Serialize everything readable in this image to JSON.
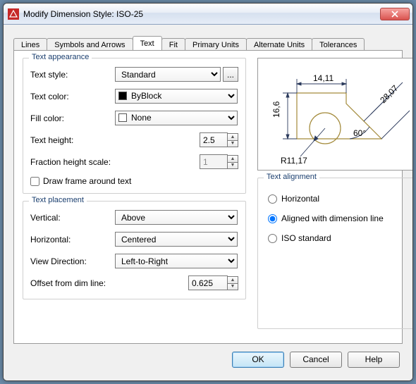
{
  "window": {
    "title": "Modify Dimension Style: ISO-25"
  },
  "tabs": {
    "items": [
      {
        "label": "Lines"
      },
      {
        "label": "Symbols and Arrows"
      },
      {
        "label": "Text"
      },
      {
        "label": "Fit"
      },
      {
        "label": "Primary Units"
      },
      {
        "label": "Alternate Units"
      },
      {
        "label": "Tolerances"
      }
    ],
    "active_index": 2
  },
  "text_appearance": {
    "legend": "Text appearance",
    "text_style_label": "Text style:",
    "text_style_value": "Standard",
    "text_color_label": "Text color:",
    "text_color_value": "ByBlock",
    "fill_color_label": "Fill color:",
    "fill_color_value": "None",
    "text_height_label": "Text height:",
    "text_height_value": "2.5",
    "fraction_scale_label": "Fraction height scale:",
    "fraction_scale_value": "1",
    "draw_frame_label": "Draw frame around text",
    "draw_frame_checked": false
  },
  "text_placement": {
    "legend": "Text placement",
    "vertical_label": "Vertical:",
    "vertical_value": "Above",
    "horizontal_label": "Horizontal:",
    "horizontal_value": "Centered",
    "view_direction_label": "View Direction:",
    "view_direction_value": "Left-to-Right",
    "offset_label": "Offset from dim line:",
    "offset_value": "0.625"
  },
  "text_alignment": {
    "legend": "Text alignment",
    "horizontal_label": "Horizontal",
    "aligned_label": "Aligned with dimension line",
    "iso_label": "ISO standard",
    "selected": "aligned"
  },
  "preview": {
    "dim_top": "14,11",
    "dim_left": "16,6",
    "dim_radius": "R11,17",
    "dim_angle": "60°",
    "dim_diag": "28,07"
  },
  "buttons": {
    "ok": "OK",
    "cancel": "Cancel",
    "help": "Help"
  },
  "ellipsis": "..."
}
